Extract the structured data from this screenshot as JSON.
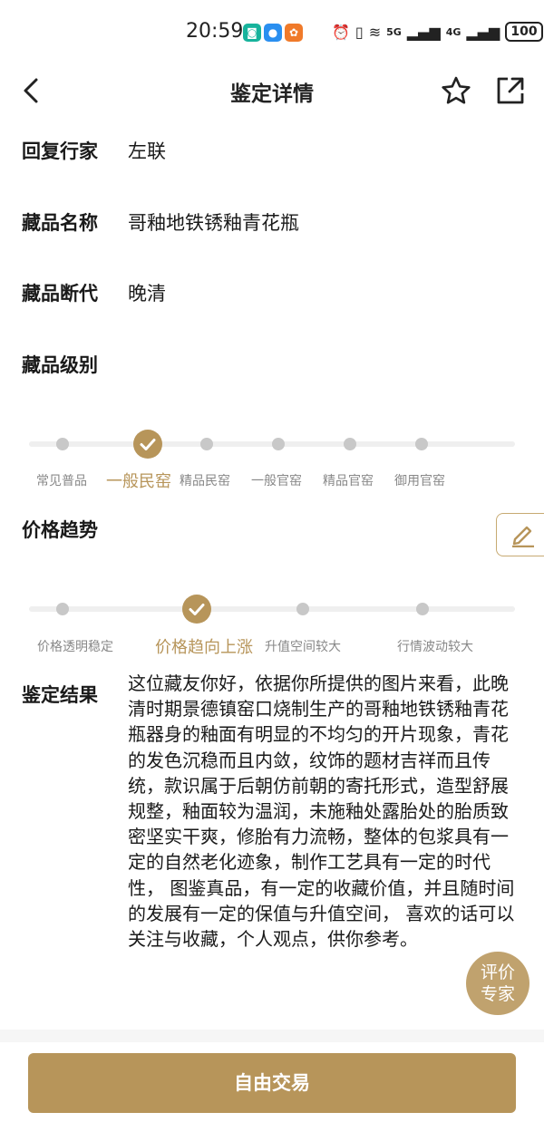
{
  "status_bar": {
    "time": "20:59",
    "battery": "100",
    "network_5g": "5G",
    "network_4g": "4G"
  },
  "nav": {
    "title": "鉴定详情"
  },
  "fields": {
    "expert_label": "回复行家",
    "expert_value": "左联",
    "name_label": "藏品名称",
    "name_value": "哥釉地铁锈釉青花瓶",
    "era_label": "藏品断代",
    "era_value": "晚清",
    "level_label": "藏品级别",
    "trend_label": "价格趋势",
    "result_label": "鉴定结果"
  },
  "level_steps": {
    "labels": [
      "常见普品",
      "一般民窑",
      "精品民窑",
      "一般官窑",
      "精品官窑",
      "御用官窑"
    ],
    "selected_index": 1
  },
  "trend_steps": {
    "labels": [
      "价格透明稳定",
      "价格趋向上涨",
      "升值空间较大",
      "行情波动较大"
    ],
    "selected_index": 1
  },
  "result": {
    "text": "这位藏友你好，依据你所提供的图片来看，此晚清时期景德镇窑口烧制生产的哥釉地铁锈釉青花瓶器身的釉面有明显的不均匀的开片现象，青花的发色沉稳而且内敛，纹饰的题材吉祥而且传统，款识属于后朝仿前朝的寄托形式，造型舒展规整，釉面较为温润，未施釉处露胎处的胎质致密坚实干爽，修胎有力流畅，整体的包浆具有一定的自然老化迹象，制作工艺具有一定的时代性， 图鉴真品，有一定的收藏价值，并且随时间的发展有一定的保值与升值空间， 喜欢的话可以关注与收藏，个人观点，供你参考。"
  },
  "float_badge": {
    "line1": "评价",
    "line2": "专家"
  },
  "bottom": {
    "trade_label": "自由交易"
  },
  "colors": {
    "accent": "#b7955a",
    "inactive_dot": "#c8c8c8",
    "track": "#efefef"
  }
}
